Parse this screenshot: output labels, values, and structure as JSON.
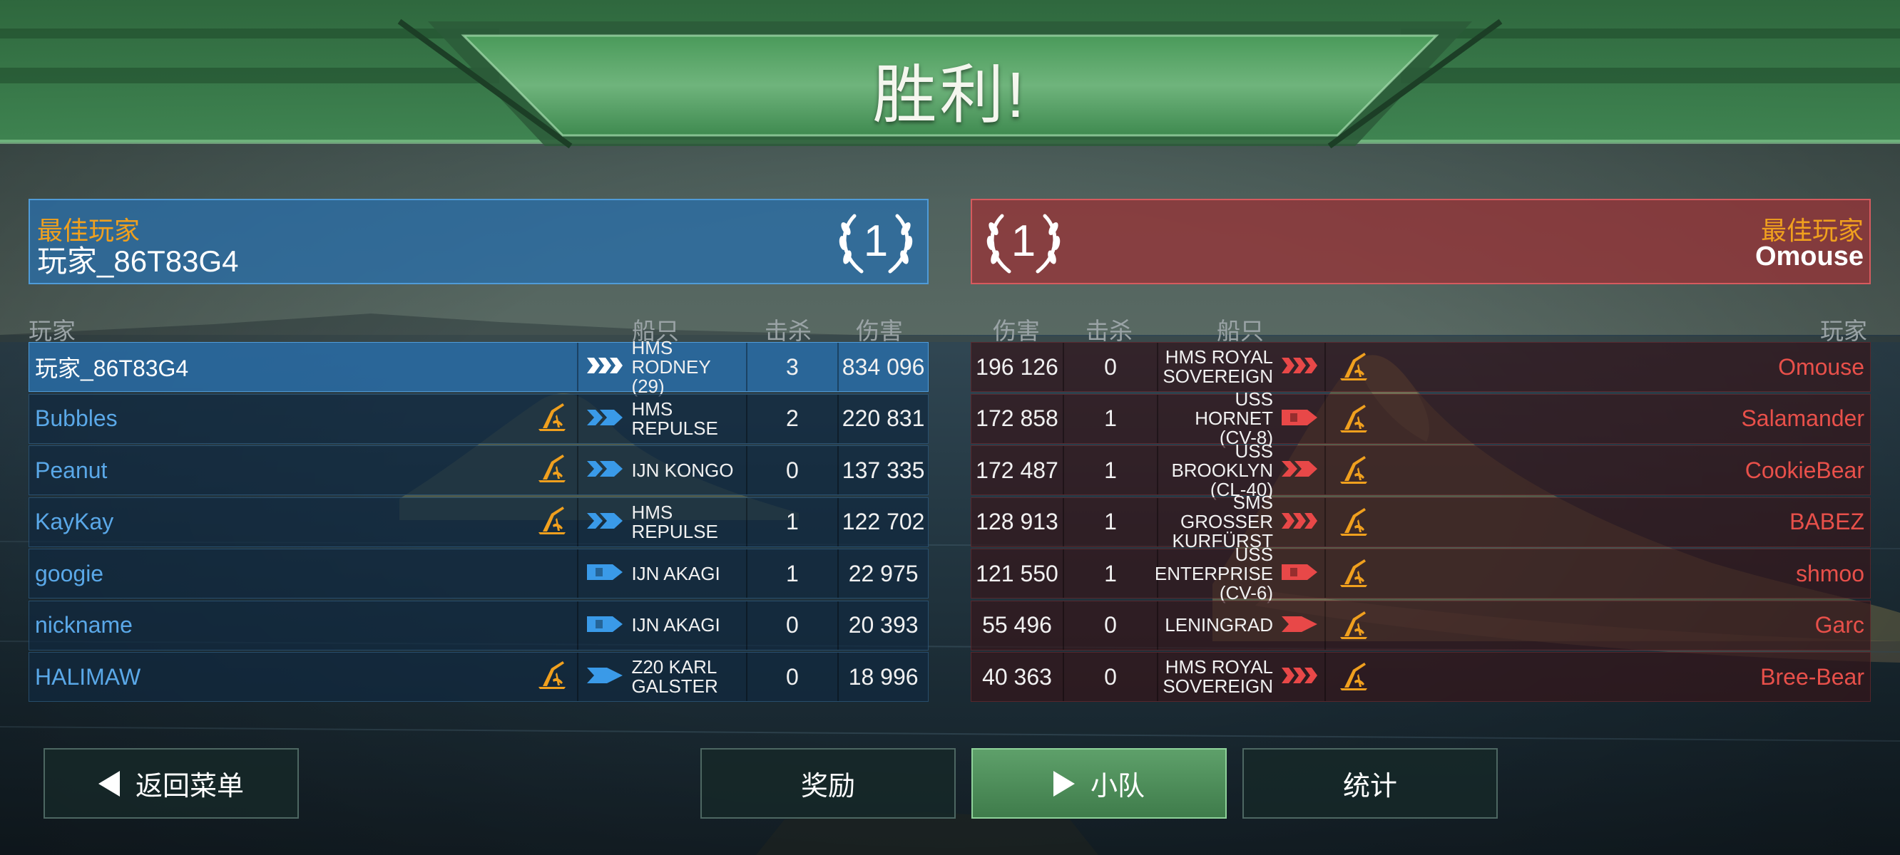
{
  "title": "胜利!",
  "best_left": {
    "label": "最佳玩家",
    "name": "玩家_86T83G4",
    "rank": "1"
  },
  "best_right": {
    "label": "最佳玩家",
    "name": "Omouse",
    "rank": "1"
  },
  "headers_left": {
    "player": "玩家",
    "ship": "船只",
    "kills": "击杀",
    "damage": "伤害"
  },
  "headers_right": {
    "damage": "伤害",
    "kills": "击杀",
    "ship": "船只",
    "player": "玩家"
  },
  "colors": {
    "ally": "#5aa8e8",
    "enemy": "#e8504a",
    "gold": "#f0a01e",
    "victory_green": "#4a9a5a"
  },
  "left_team": [
    {
      "name": "玩家_86T83G4",
      "crane": false,
      "ship_line1": "HMS RODNEY",
      "ship_line2": "(29)",
      "class_icon": "battleship-icon",
      "kills": "3",
      "damage": "834 096"
    },
    {
      "name": "Bubbles",
      "crane": true,
      "ship_line1": "HMS REPULSE",
      "ship_line2": "",
      "class_icon": "battlecruiser-icon",
      "kills": "2",
      "damage": "220 831"
    },
    {
      "name": "Peanut",
      "crane": true,
      "ship_line1": "IJN KONGO",
      "ship_line2": "",
      "class_icon": "battlecruiser-icon",
      "kills": "0",
      "damage": "137 335"
    },
    {
      "name": "KayKay",
      "crane": true,
      "ship_line1": "HMS REPULSE",
      "ship_line2": "",
      "class_icon": "battlecruiser-icon",
      "kills": "1",
      "damage": "122 702"
    },
    {
      "name": "googie",
      "crane": false,
      "ship_line1": "IJN AKAGI",
      "ship_line2": "",
      "class_icon": "carrier-icon",
      "kills": "1",
      "damage": "22 975"
    },
    {
      "name": "nickname",
      "crane": false,
      "ship_line1": "IJN AKAGI",
      "ship_line2": "",
      "class_icon": "carrier-icon",
      "kills": "0",
      "damage": "20 393"
    },
    {
      "name": "HALIMAW",
      "crane": true,
      "ship_line1": "Z20 KARL",
      "ship_line2": "GALSTER",
      "class_icon": "destroyer-icon",
      "kills": "0",
      "damage": "18 996"
    }
  ],
  "right_team": [
    {
      "damage": "196 126",
      "kills": "0",
      "ship_line1": "HMS ROYAL",
      "ship_line2": "SOVEREIGN",
      "class_icon": "battleship-icon",
      "name": "Omouse"
    },
    {
      "damage": "172 858",
      "kills": "1",
      "ship_line1": "USS HORNET",
      "ship_line2": "(CV-8)",
      "class_icon": "carrier-icon",
      "name": "Salamander"
    },
    {
      "damage": "172 487",
      "kills": "1",
      "ship_line1": "USS BROOKLYN",
      "ship_line2": "(CL-40)",
      "class_icon": "battlecruiser-icon",
      "name": "CookieBear"
    },
    {
      "damage": "128 913",
      "kills": "1",
      "ship_line1": "SMS GROSSER",
      "ship_line2": "KURFÜRST",
      "class_icon": "battleship-icon",
      "name": "BABEZ"
    },
    {
      "damage": "121 550",
      "kills": "1",
      "ship_line1": "USS ENTERPRISE",
      "ship_line2": "(CV-6)",
      "class_icon": "carrier-icon",
      "name": "shmoo"
    },
    {
      "damage": "55 496",
      "kills": "0",
      "ship_line1": "LENINGRAD",
      "ship_line2": "",
      "class_icon": "destroyer-icon",
      "name": "Garc"
    },
    {
      "damage": "40 363",
      "kills": "0",
      "ship_line1": "HMS ROYAL",
      "ship_line2": "SOVEREIGN",
      "class_icon": "battleship-icon",
      "name": "Bree-Bear"
    }
  ],
  "buttons": {
    "back": "返回菜单",
    "rewards": "奖励",
    "squad": "小队",
    "stats": "统计"
  }
}
